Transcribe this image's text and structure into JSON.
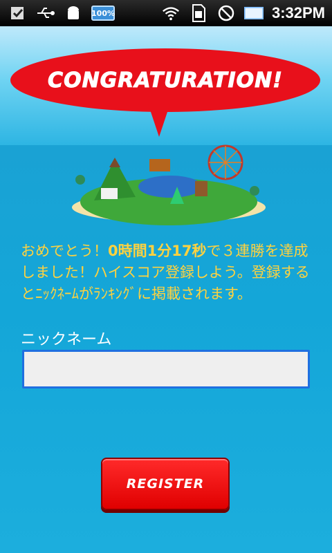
{
  "status_bar": {
    "battery_percent": "100%",
    "time": "3:32PM",
    "icons": [
      "download-check-icon",
      "usb-icon",
      "android-debug-icon",
      "battery-badge-icon",
      "wifi-icon",
      "sim-icon",
      "no-signal-icon",
      "blank-rectangle-icon"
    ]
  },
  "banner": {
    "text": "CONGRATURATION!"
  },
  "message": {
    "part1": "おめでとう！",
    "time_value": "0時間1分17秒",
    "part2": "で３連勝を達成しました！ハイスコア登録しよう。登録するとﾆｯｸﾈｰﾑがﾗﾝｷﾝｸﾞに掲載されます。"
  },
  "nickname": {
    "label": "ニックネーム",
    "value": "",
    "placeholder": ""
  },
  "register_button": {
    "label": "REGISTER"
  },
  "colors": {
    "accent_red": "#e8101b",
    "message_yellow": "#ffd23f",
    "sea_blue": "#1aa7d6",
    "input_border": "#1f6fe0"
  }
}
